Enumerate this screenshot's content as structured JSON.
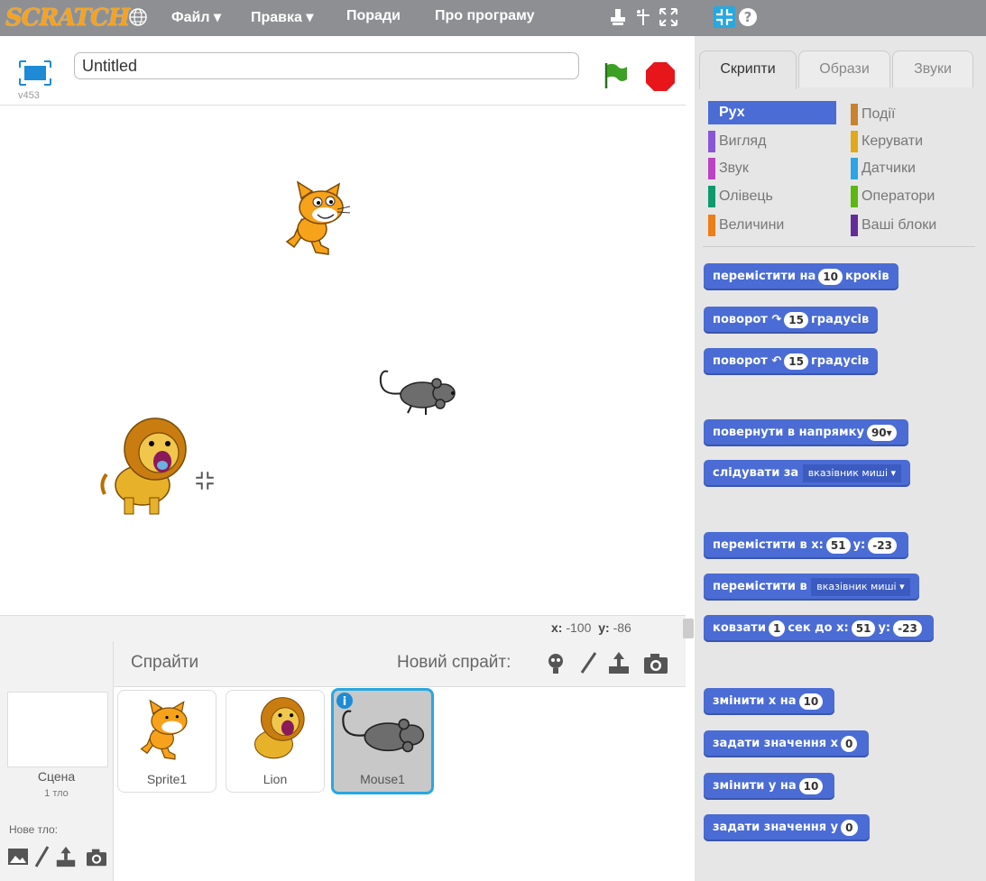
{
  "app": {
    "logo": "SCRATCH"
  },
  "menu": {
    "file": "Файл ▾",
    "edit": "Правка ▾",
    "tips": "Поради",
    "about": "Про програму"
  },
  "stage": {
    "title_value": "Untitled",
    "version": "v453"
  },
  "coords": {
    "x_label": "x:",
    "x_value": "-100",
    "y_label": "y:",
    "y_value": "-86"
  },
  "sprites_pane": {
    "header": "Спрайти",
    "new_sprite_label": "Новий спрайт:",
    "stage_label": "Сцена",
    "stage_backdrops": "1 тло",
    "new_backdrop_label": "Нове тло:",
    "sprites": [
      {
        "name": "Sprite1"
      },
      {
        "name": "Lion"
      },
      {
        "name": "Mouse1"
      }
    ]
  },
  "tabs": {
    "scripts": "Скрипти",
    "costumes": "Образи",
    "sounds": "Звуки"
  },
  "categories": [
    {
      "label": "Рух",
      "color": "#4a6cd4"
    },
    {
      "label": "Події",
      "color": "#c88330"
    },
    {
      "label": "Вигляд",
      "color": "#8a55d7"
    },
    {
      "label": "Керувати",
      "color": "#e1a91a"
    },
    {
      "label": "Звук",
      "color": "#bb42c3"
    },
    {
      "label": "Датчики",
      "color": "#2ca5e2"
    },
    {
      "label": "Олівець",
      "color": "#0e9a6c"
    },
    {
      "label": "Оператори",
      "color": "#5cb712"
    },
    {
      "label": "Величини",
      "color": "#ee7d16"
    },
    {
      "label": "Ваші блоки",
      "color": "#632d99"
    }
  ],
  "blocks": {
    "move": {
      "a": "перемістити на",
      "v": "10",
      "b": "кроків"
    },
    "turn_right": {
      "a": "поворот",
      "icon": "↷",
      "v": "15",
      "b": "градусів"
    },
    "turn_left": {
      "a": "поворот",
      "icon": "↶",
      "v": "15",
      "b": "градусів"
    },
    "point_dir": {
      "a": "повернути в напрямку",
      "v": "90▾"
    },
    "point_towards": {
      "a": "слідувати за",
      "v": "вказівник миші ▾"
    },
    "goto_xy": {
      "a": "перемістити в x:",
      "v1": "51",
      "b": "y:",
      "v2": "-23"
    },
    "goto": {
      "a": "перемістити в",
      "v": "вказівник миші ▾"
    },
    "glide": {
      "a": "ковзати",
      "v1": "1",
      "b": "сек до x:",
      "v2": "51",
      "c": "y:",
      "v3": "-23"
    },
    "change_x": {
      "a": "змінити х на",
      "v": "10"
    },
    "set_x": {
      "a": "задати значення х",
      "v": "0"
    },
    "change_y": {
      "a": "змінити у на",
      "v": "10"
    },
    "set_y": {
      "a": "задати значення у",
      "v": "0"
    }
  }
}
